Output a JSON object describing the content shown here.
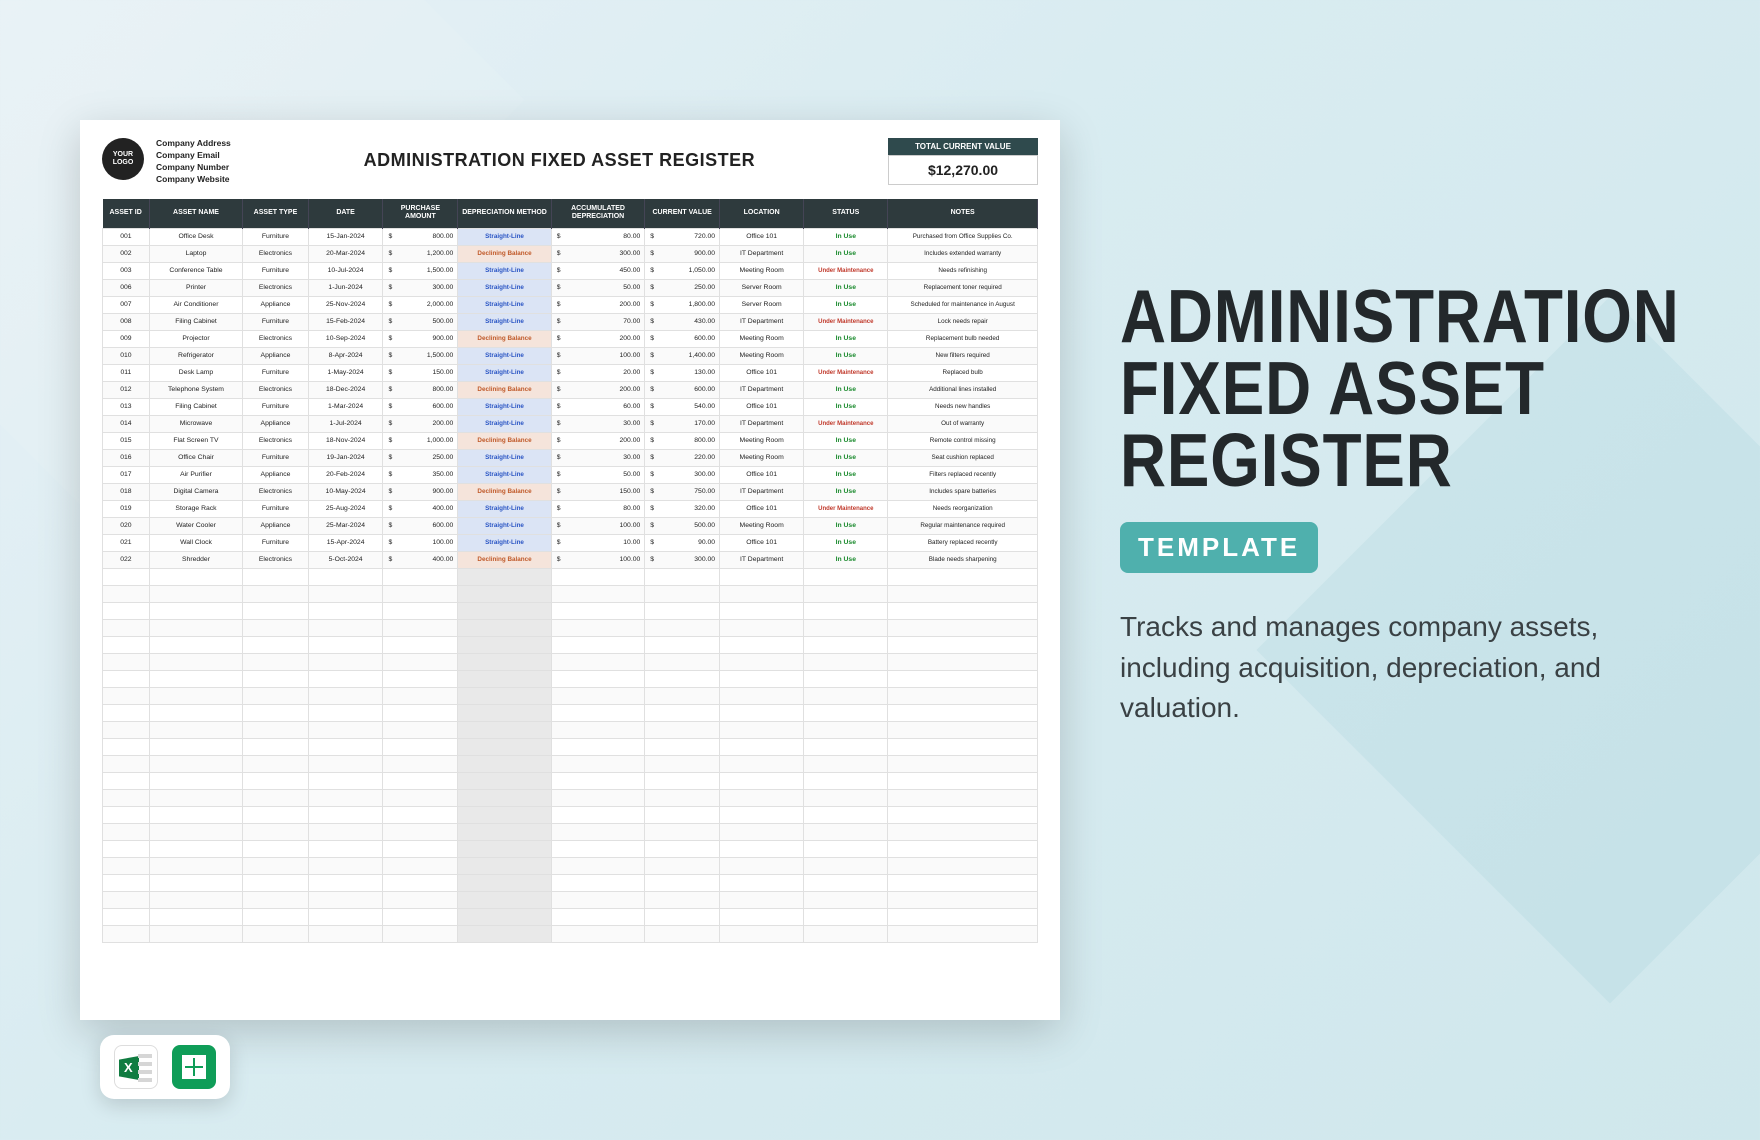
{
  "promo": {
    "title_line1": "Administration",
    "title_line2": "Fixed Asset",
    "title_line3": "Register",
    "tag": "Template",
    "description": "Tracks and manages company assets, including acquisition, depreciation, and valuation."
  },
  "sheet": {
    "logo_text": "YOUR LOGO",
    "company": {
      "address": "Company Address",
      "email": "Company Email",
      "number": "Company Number",
      "website": "Company Website"
    },
    "title": "ADMINISTRATION FIXED ASSET REGISTER",
    "total_label": "TOTAL CURRENT VALUE",
    "total_value": "$12,270.00",
    "columns": [
      "ASSET ID",
      "ASSET NAME",
      "ASSET TYPE",
      "DATE",
      "PURCHASE AMOUNT",
      "DEPRECIATION METHOD",
      "ACCUMULATED DEPRECIATION",
      "CURRENT VALUE",
      "LOCATION",
      "STATUS",
      "NOTES"
    ],
    "rows": [
      {
        "id": "001",
        "name": "Office Desk",
        "type": "Furniture",
        "date": "15-Jan-2024",
        "purchase": "800.00",
        "dep": "Straight-Line",
        "acc": "80.00",
        "cur": "720.00",
        "loc": "Office 101",
        "status": "In Use",
        "notes": "Purchased from Office Supplies Co."
      },
      {
        "id": "002",
        "name": "Laptop",
        "type": "Electronics",
        "date": "20-Mar-2024",
        "purchase": "1,200.00",
        "dep": "Declining Balance",
        "acc": "300.00",
        "cur": "900.00",
        "loc": "IT Department",
        "status": "In Use",
        "notes": "Includes extended warranty"
      },
      {
        "id": "003",
        "name": "Conference Table",
        "type": "Furniture",
        "date": "10-Jul-2024",
        "purchase": "1,500.00",
        "dep": "Straight-Line",
        "acc": "450.00",
        "cur": "1,050.00",
        "loc": "Meeting Room",
        "status": "Under Maintenance",
        "notes": "Needs refinishing"
      },
      {
        "id": "006",
        "name": "Printer",
        "type": "Electronics",
        "date": "1-Jun-2024",
        "purchase": "300.00",
        "dep": "Straight-Line",
        "acc": "50.00",
        "cur": "250.00",
        "loc": "Server Room",
        "status": "In Use",
        "notes": "Replacement toner required"
      },
      {
        "id": "007",
        "name": "Air Conditioner",
        "type": "Appliance",
        "date": "25-Nov-2024",
        "purchase": "2,000.00",
        "dep": "Straight-Line",
        "acc": "200.00",
        "cur": "1,800.00",
        "loc": "Server Room",
        "status": "In Use",
        "notes": "Scheduled for maintenance in August"
      },
      {
        "id": "008",
        "name": "Filing Cabinet",
        "type": "Furniture",
        "date": "15-Feb-2024",
        "purchase": "500.00",
        "dep": "Straight-Line",
        "acc": "70.00",
        "cur": "430.00",
        "loc": "IT Department",
        "status": "Under Maintenance",
        "notes": "Lock needs repair"
      },
      {
        "id": "009",
        "name": "Projector",
        "type": "Electronics",
        "date": "10-Sep-2024",
        "purchase": "900.00",
        "dep": "Declining Balance",
        "acc": "200.00",
        "cur": "600.00",
        "loc": "Meeting Room",
        "status": "In Use",
        "notes": "Replacement bulb needed"
      },
      {
        "id": "010",
        "name": "Refrigerator",
        "type": "Appliance",
        "date": "8-Apr-2024",
        "purchase": "1,500.00",
        "dep": "Straight-Line",
        "acc": "100.00",
        "cur": "1,400.00",
        "loc": "Meeting Room",
        "status": "In Use",
        "notes": "New filters required"
      },
      {
        "id": "011",
        "name": "Desk Lamp",
        "type": "Furniture",
        "date": "1-May-2024",
        "purchase": "150.00",
        "dep": "Straight-Line",
        "acc": "20.00",
        "cur": "130.00",
        "loc": "Office 101",
        "status": "Under Maintenance",
        "notes": "Replaced bulb"
      },
      {
        "id": "012",
        "name": "Telephone System",
        "type": "Electronics",
        "date": "18-Dec-2024",
        "purchase": "800.00",
        "dep": "Declining Balance",
        "acc": "200.00",
        "cur": "600.00",
        "loc": "IT Department",
        "status": "In Use",
        "notes": "Additional lines installed"
      },
      {
        "id": "013",
        "name": "Filing Cabinet",
        "type": "Furniture",
        "date": "1-Mar-2024",
        "purchase": "600.00",
        "dep": "Straight-Line",
        "acc": "60.00",
        "cur": "540.00",
        "loc": "Office 101",
        "status": "In Use",
        "notes": "Needs new handles"
      },
      {
        "id": "014",
        "name": "Microwave",
        "type": "Appliance",
        "date": "1-Jul-2024",
        "purchase": "200.00",
        "dep": "Straight-Line",
        "acc": "30.00",
        "cur": "170.00",
        "loc": "IT Department",
        "status": "Under Maintenance",
        "notes": "Out of warranty"
      },
      {
        "id": "015",
        "name": "Flat Screen TV",
        "type": "Electronics",
        "date": "18-Nov-2024",
        "purchase": "1,000.00",
        "dep": "Declining Balance",
        "acc": "200.00",
        "cur": "800.00",
        "loc": "Meeting Room",
        "status": "In Use",
        "notes": "Remote control missing"
      },
      {
        "id": "016",
        "name": "Office Chair",
        "type": "Furniture",
        "date": "19-Jan-2024",
        "purchase": "250.00",
        "dep": "Straight-Line",
        "acc": "30.00",
        "cur": "220.00",
        "loc": "Meeting Room",
        "status": "In Use",
        "notes": "Seat cushion replaced"
      },
      {
        "id": "017",
        "name": "Air Purifier",
        "type": "Appliance",
        "date": "20-Feb-2024",
        "purchase": "350.00",
        "dep": "Straight-Line",
        "acc": "50.00",
        "cur": "300.00",
        "loc": "Office 101",
        "status": "In Use",
        "notes": "Filters replaced recently"
      },
      {
        "id": "018",
        "name": "Digital Camera",
        "type": "Electronics",
        "date": "10-May-2024",
        "purchase": "900.00",
        "dep": "Declining Balance",
        "acc": "150.00",
        "cur": "750.00",
        "loc": "IT Department",
        "status": "In Use",
        "notes": "Includes spare batteries"
      },
      {
        "id": "019",
        "name": "Storage Rack",
        "type": "Furniture",
        "date": "25-Aug-2024",
        "purchase": "400.00",
        "dep": "Straight-Line",
        "acc": "80.00",
        "cur": "320.00",
        "loc": "Office 101",
        "status": "Under Maintenance",
        "notes": "Needs reorganization"
      },
      {
        "id": "020",
        "name": "Water Cooler",
        "type": "Appliance",
        "date": "25-Mar-2024",
        "purchase": "600.00",
        "dep": "Straight-Line",
        "acc": "100.00",
        "cur": "500.00",
        "loc": "Meeting Room",
        "status": "In Use",
        "notes": "Regular maintenance required"
      },
      {
        "id": "021",
        "name": "Wall Clock",
        "type": "Furniture",
        "date": "15-Apr-2024",
        "purchase": "100.00",
        "dep": "Straight-Line",
        "acc": "10.00",
        "cur": "90.00",
        "loc": "Office 101",
        "status": "In Use",
        "notes": "Battery replaced recently"
      },
      {
        "id": "022",
        "name": "Shredder",
        "type": "Electronics",
        "date": "5-Oct-2024",
        "purchase": "400.00",
        "dep": "Declining Balance",
        "acc": "100.00",
        "cur": "300.00",
        "loc": "IT Department",
        "status": "In Use",
        "notes": "Blade needs sharpening"
      }
    ],
    "empty_rows": 22
  },
  "icons": {
    "excel": "excel-icon",
    "sheets": "google-sheets-icon"
  }
}
